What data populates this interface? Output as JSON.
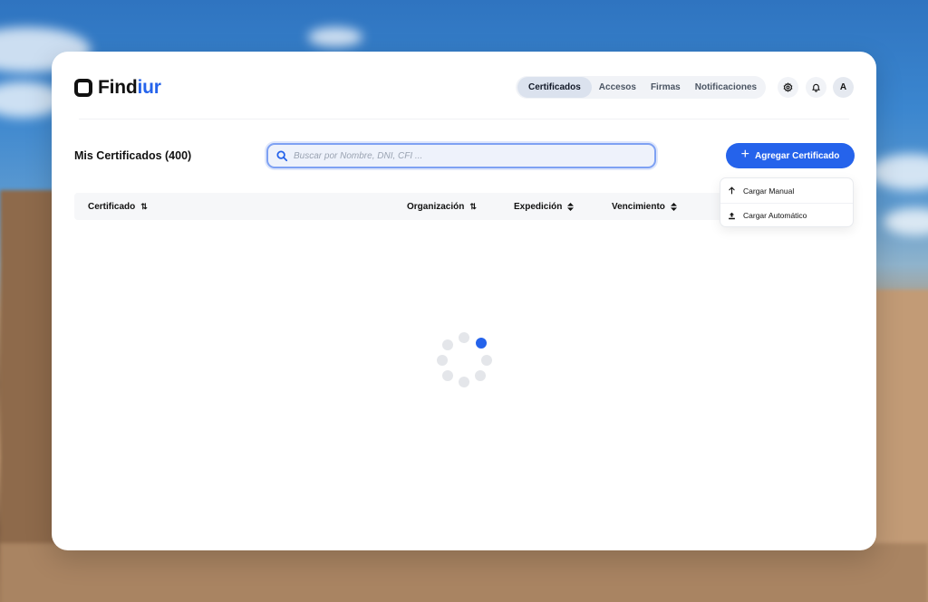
{
  "app": {
    "logo_text_main": "Find",
    "logo_text_accent": "iur",
    "brand_color": "#2563eb"
  },
  "topnav": {
    "tabs": [
      {
        "label": "Certificados",
        "active": true
      },
      {
        "label": "Accesos",
        "active": false
      },
      {
        "label": "Firmas",
        "active": false
      },
      {
        "label": "Notificaciones",
        "active": false
      }
    ],
    "settings_icon": "gear-icon",
    "notifications_icon": "bell-icon",
    "avatar_initial": "A"
  },
  "page": {
    "title": "Mis Certificados (400)"
  },
  "search": {
    "placeholder": "Buscar por Nombre, DNI, CFI ...",
    "value": "",
    "icon": "search-icon"
  },
  "actions": {
    "add_label": "Agregar Certificado",
    "dropdown": [
      {
        "label": "Cargar Manual",
        "icon": "arrow-up-icon"
      },
      {
        "label": "Cargar Automático",
        "icon": "upload-icon"
      }
    ]
  },
  "table": {
    "columns": [
      {
        "label": "Certificado",
        "sort_icon": "sort-arrows-icon"
      },
      {
        "label": "Organización",
        "sort_icon": "sort-arrows-icon"
      },
      {
        "label": "Expedición",
        "sort_icon": "sort-caret-icon"
      },
      {
        "label": "Vencimiento",
        "sort_icon": "sort-caret-icon"
      }
    ],
    "loading": true
  }
}
